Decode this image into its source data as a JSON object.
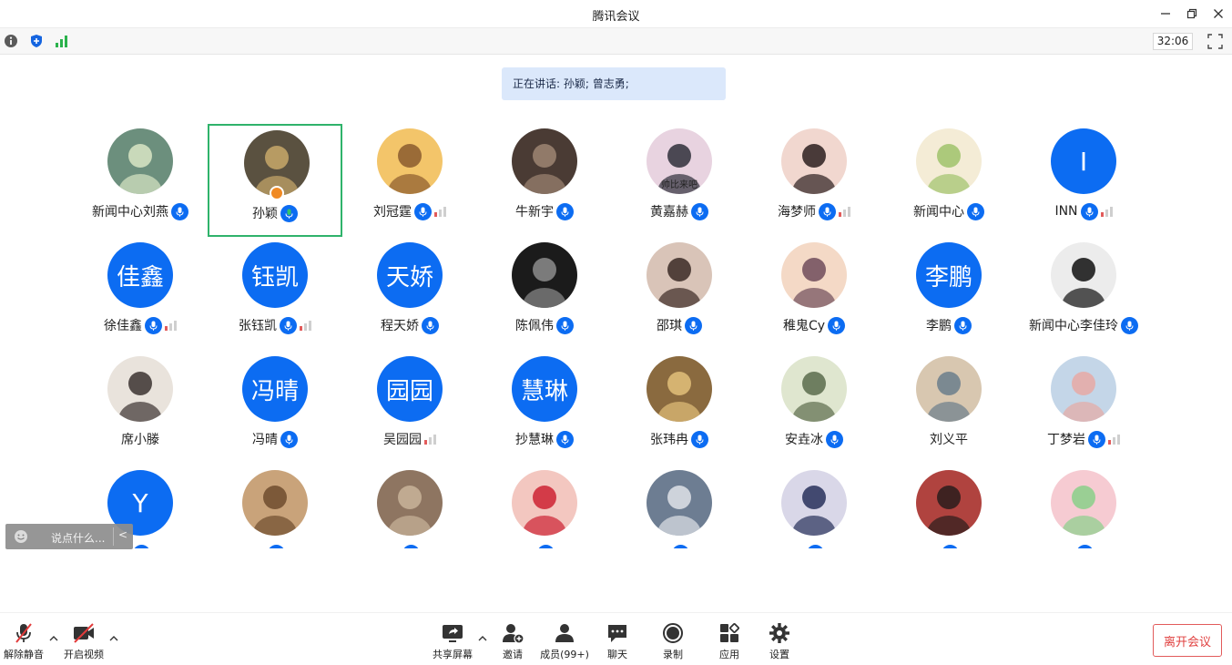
{
  "window": {
    "title": "腾讯会议"
  },
  "status": {
    "timer": "32:06"
  },
  "speaking": {
    "text": "正在讲话: 孙颖; 曾志勇;"
  },
  "colors": {
    "accent": "#0c6cf2",
    "active_border": "#2fb36b",
    "leave": "#e0403f",
    "banner": "#dbe8fb"
  },
  "participants": [
    {
      "name": "新闻中心刘燕",
      "avatar": "photo",
      "signal": false
    },
    {
      "name": "孙颖",
      "avatar": "photo",
      "signal": false,
      "active": true,
      "host": true
    },
    {
      "name": "刘冠霆",
      "avatar": "photo",
      "signal": true
    },
    {
      "name": "牛新宇",
      "avatar": "photo",
      "signal": false
    },
    {
      "name": "黄嘉赫",
      "avatar": "photo",
      "avatar_caption": "帅比来吧",
      "signal": false
    },
    {
      "name": "海梦师",
      "avatar": "photo",
      "signal": true
    },
    {
      "name": "新闻中心",
      "avatar": "photo",
      "signal": false
    },
    {
      "name": "INN",
      "avatar": "text",
      "avatar_text": "I",
      "signal": true
    },
    {
      "name": "徐佳鑫",
      "avatar": "text",
      "avatar_text": "佳鑫",
      "signal": true
    },
    {
      "name": "张钰凯",
      "avatar": "text",
      "avatar_text": "钰凯",
      "signal": true
    },
    {
      "name": "程天娇",
      "avatar": "text",
      "avatar_text": "天娇",
      "signal": false
    },
    {
      "name": "陈佩伟",
      "avatar": "photo",
      "signal": false
    },
    {
      "name": "邵琪",
      "avatar": "photo",
      "signal": false
    },
    {
      "name": "稚鬼Cy",
      "avatar": "photo",
      "signal": false
    },
    {
      "name": "李鹏",
      "avatar": "text",
      "avatar_text": "李鹏",
      "signal": false
    },
    {
      "name": "新闻中心李佳玲",
      "avatar": "photo",
      "signal": false
    },
    {
      "name": "席小滕",
      "avatar": "photo",
      "signal": false,
      "no_mic": true
    },
    {
      "name": "冯晴",
      "avatar": "text",
      "avatar_text": "冯晴",
      "signal": false
    },
    {
      "name": "吴园园",
      "avatar": "text",
      "avatar_text": "园园",
      "signal": true,
      "no_mic": true
    },
    {
      "name": "抄慧琳",
      "avatar": "text",
      "avatar_text": "慧琳",
      "signal": false
    },
    {
      "name": "张玮冉",
      "avatar": "photo",
      "signal": false
    },
    {
      "name": "安垚冰",
      "avatar": "photo",
      "signal": false
    },
    {
      "name": "刘义平",
      "avatar": "photo",
      "signal": false,
      "no_mic": true
    },
    {
      "name": "丁梦岩",
      "avatar": "photo",
      "signal": true
    },
    {
      "name": "",
      "avatar": "text",
      "avatar_text": "Y",
      "signal": false
    },
    {
      "name": "",
      "avatar": "photo",
      "signal": false
    },
    {
      "name": "",
      "avatar": "photo",
      "signal": false
    },
    {
      "name": "",
      "avatar": "photo",
      "signal": false
    },
    {
      "name": "",
      "avatar": "photo",
      "signal": false
    },
    {
      "name": "",
      "avatar": "photo",
      "signal": false
    },
    {
      "name": "",
      "avatar": "photo",
      "signal": false
    },
    {
      "name": "",
      "avatar": "photo",
      "signal": false
    }
  ],
  "chat": {
    "placeholder": "说点什么...",
    "collapse": "<"
  },
  "toolbar": {
    "unmute": "解除静音",
    "start_video": "开启视频",
    "share_screen": "共享屏幕",
    "invite": "邀请",
    "members": "成员(99+)",
    "chat": "聊天",
    "record": "录制",
    "apps": "应用",
    "settings": "设置",
    "leave": "离开会议"
  }
}
